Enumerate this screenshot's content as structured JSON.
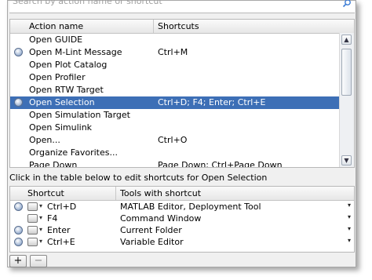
{
  "search": {
    "placeholder": "Search by action name or shortcut"
  },
  "actions_table": {
    "columns": [
      "Action name",
      "Shortcuts"
    ],
    "rows": [
      {
        "name": "Open GUIDE",
        "shortcut": "",
        "icon": ""
      },
      {
        "name": "Open M-Lint Message",
        "shortcut": "Ctrl+M",
        "icon": "info-icon"
      },
      {
        "name": "Open Plot Catalog",
        "shortcut": "",
        "icon": ""
      },
      {
        "name": "Open Profiler",
        "shortcut": "",
        "icon": ""
      },
      {
        "name": "Open RTW Target",
        "shortcut": "",
        "icon": ""
      },
      {
        "name": "Open Selection",
        "shortcut": "Ctrl+D; F4; Enter; Ctrl+E",
        "icon": "info-icon",
        "selected": true
      },
      {
        "name": "Open Simulation Target",
        "shortcut": "",
        "icon": ""
      },
      {
        "name": "Open Simulink",
        "shortcut": "",
        "icon": ""
      },
      {
        "name": "Open...",
        "shortcut": "Ctrl+O",
        "icon": ""
      },
      {
        "name": "Organize Favorites...",
        "shortcut": "",
        "icon": ""
      },
      {
        "name": "Page Down",
        "shortcut": "Page Down; Ctrl+Page Down",
        "icon": ""
      }
    ]
  },
  "caption": "Click in the table below to edit shortcuts for Open Selection",
  "shortcuts_table": {
    "columns": [
      "Shortcut",
      "Tools with shortcut"
    ],
    "rows": [
      {
        "key": "Ctrl+D",
        "tools": "MATLAB Editor, Deployment Tool",
        "info": true
      },
      {
        "key": "F4",
        "tools": "Command Window",
        "info": false
      },
      {
        "key": "Enter",
        "tools": "Current Folder",
        "info": true
      },
      {
        "key": "Ctrl+E",
        "tools": "Variable Editor",
        "info": true
      }
    ]
  },
  "buttons": {
    "add": "+",
    "remove": "−"
  },
  "colors": {
    "selection": "#3d6fb6",
    "accent": "#3a7bd5"
  }
}
